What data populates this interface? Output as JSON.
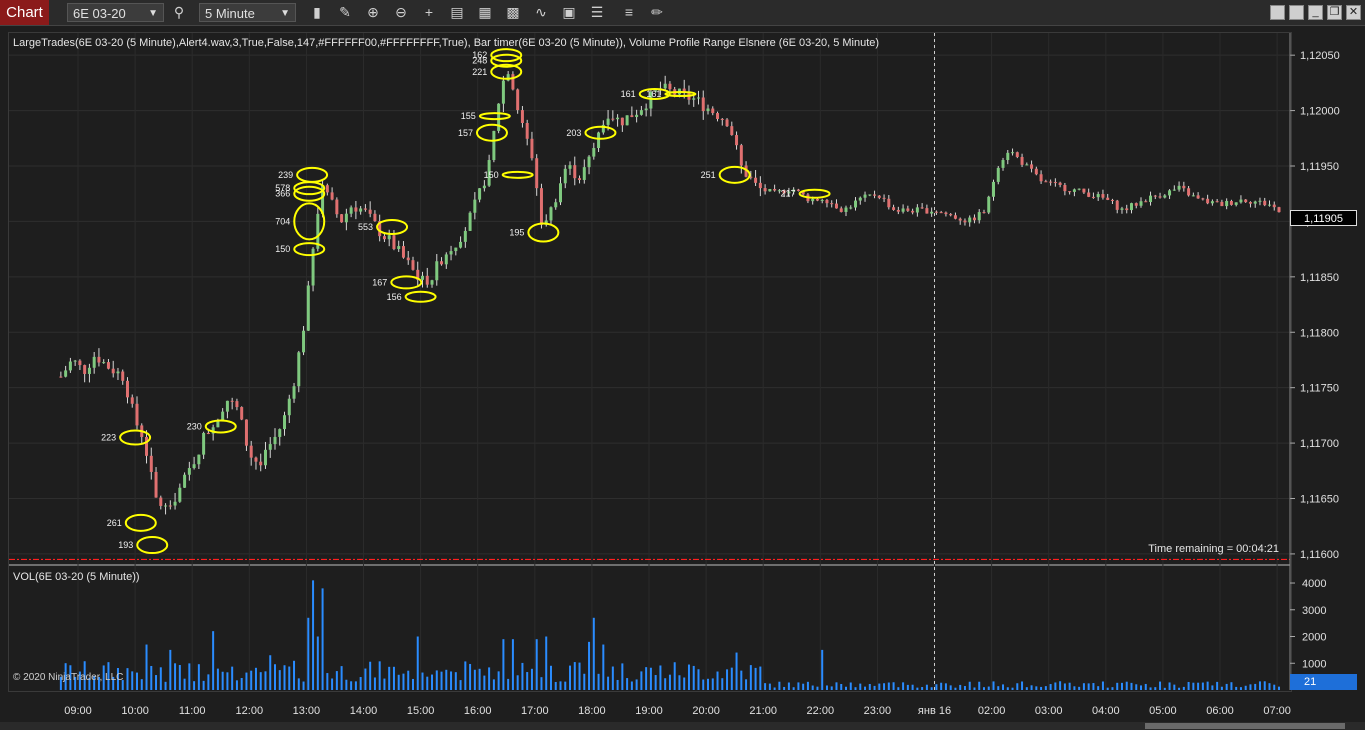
{
  "toolbar": {
    "tab": "Chart",
    "instrument": "6E 03-20",
    "interval": "5 Minute",
    "icons": [
      "search-icon",
      "bars-type-icon",
      "draw-icon",
      "zoom-in-icon",
      "zoom-out-icon",
      "crosshair-icon",
      "data-box-icon",
      "properties-icon",
      "strategies-icon",
      "indicators-icon",
      "templates-icon",
      "list-icon",
      "order-icon",
      "pencil-icon"
    ]
  },
  "panel": {
    "indicator_text": "LargeTrades(6E 03-20 (5 Minute),Alert4.wav,3,True,False,147,#FFFFFF00,#FFFFFFFF,True), Bar timer(6E 03-20 (5 Minute)), Volume Profile Range Elsnere (6E 03-20, 5 Minute)",
    "volume_title": "VOL(6E 03-20 (5 Minute))",
    "copyright": "© 2020 NinjaTrader, LLC",
    "time_remaining": "Time remaining = 00:04:21",
    "last_price": "1,11905",
    "last_volume": "21"
  },
  "colors": {
    "up": "#7fc97f",
    "down": "#e07070",
    "wick": "#d8d8d8",
    "ellipse": "#ffff00",
    "volume": "#2a8cff",
    "hline": "#ff2020"
  },
  "chart_data": {
    "type": "candlestick",
    "x_ticks": [
      "09:00",
      "10:00",
      "11:00",
      "12:00",
      "13:00",
      "14:00",
      "15:00",
      "16:00",
      "17:00",
      "18:00",
      "19:00",
      "20:00",
      "21:00",
      "22:00",
      "23:00",
      "янв 16",
      "02:00",
      "03:00",
      "04:00",
      "05:00",
      "06:00",
      "07:00"
    ],
    "y_ticks": [
      "1,12050",
      "1,12000",
      "1,11950",
      "1,11900",
      "1,11850",
      "1,11800",
      "1,11750",
      "1,11700",
      "1,11650",
      "1,11600"
    ],
    "ylim": [
      1.1159,
      1.1207
    ],
    "volume_ticks": [
      "4000",
      "3000",
      "2000",
      "1000"
    ],
    "volume_ylim": [
      0,
      4300
    ],
    "horizontal_line": 1.11595,
    "session_break": "янв 16",
    "price_path": [
      [
        8.7,
        1.1176
      ],
      [
        8.9,
        1.11775
      ],
      [
        9.1,
        1.11765
      ],
      [
        9.3,
        1.1178
      ],
      [
        9.5,
        1.1177
      ],
      [
        9.8,
        1.1176
      ],
      [
        10.0,
        1.1172
      ],
      [
        10.15,
        1.11705
      ],
      [
        10.35,
        1.1165
      ],
      [
        10.55,
        1.1164
      ],
      [
        10.8,
        1.1166
      ],
      [
        11.0,
        1.1168
      ],
      [
        11.2,
        1.11705
      ],
      [
        11.4,
        1.1172
      ],
      [
        11.6,
        1.1174
      ],
      [
        11.8,
        1.1173
      ],
      [
        12.0,
        1.1169
      ],
      [
        12.2,
        1.1168
      ],
      [
        12.4,
        1.117
      ],
      [
        12.6,
        1.1172
      ],
      [
        12.8,
        1.1176
      ],
      [
        13.0,
        1.1182
      ],
      [
        13.1,
        1.1187
      ],
      [
        13.25,
        1.1193
      ],
      [
        13.4,
        1.1192
      ],
      [
        13.6,
        1.119
      ],
      [
        13.8,
        1.11915
      ],
      [
        14.0,
        1.1191
      ],
      [
        14.3,
        1.1189
      ],
      [
        14.5,
        1.1188
      ],
      [
        14.8,
        1.1186
      ],
      [
        15.0,
        1.11845
      ],
      [
        15.2,
        1.1185
      ],
      [
        15.4,
        1.1187
      ],
      [
        15.6,
        1.1188
      ],
      [
        15.8,
        1.11895
      ],
      [
        16.0,
        1.1192
      ],
      [
        16.2,
        1.1195
      ],
      [
        16.4,
        1.1202
      ],
      [
        16.55,
        1.1204
      ],
      [
        16.75,
        1.1199
      ],
      [
        16.95,
        1.1196
      ],
      [
        17.15,
        1.1189
      ],
      [
        17.35,
        1.1192
      ],
      [
        17.55,
        1.1195
      ],
      [
        17.8,
        1.1194
      ],
      [
        18.0,
        1.1196
      ],
      [
        18.25,
        1.12
      ],
      [
        18.5,
        1.1199
      ],
      [
        18.8,
        1.12
      ],
      [
        19.0,
        1.1201
      ],
      [
        19.2,
        1.1202
      ],
      [
        19.5,
        1.12015
      ],
      [
        19.8,
        1.1201
      ],
      [
        20.1,
        1.12
      ],
      [
        20.4,
        1.1199
      ],
      [
        20.6,
        1.1195
      ],
      [
        20.9,
        1.1193
      ],
      [
        21.2,
        1.11925
      ],
      [
        21.5,
        1.1193
      ],
      [
        21.8,
        1.1192
      ],
      [
        22.1,
        1.1192
      ],
      [
        22.4,
        1.1191
      ],
      [
        22.7,
        1.1192
      ],
      [
        23.0,
        1.11925
      ],
      [
        23.3,
        1.1191
      ],
      [
        23.6,
        1.1191
      ],
      [
        24.0,
        1.1191
      ],
      [
        24.3,
        1.11905
      ],
      [
        24.6,
        1.119
      ],
      [
        24.9,
        1.1191
      ],
      [
        25.1,
        1.1195
      ],
      [
        25.3,
        1.11965
      ],
      [
        25.6,
        1.1195
      ],
      [
        25.9,
        1.11935
      ],
      [
        26.3,
        1.1193
      ],
      [
        26.7,
        1.11925
      ],
      [
        27.0,
        1.1192
      ],
      [
        27.3,
        1.1191
      ],
      [
        27.7,
        1.1192
      ],
      [
        28.0,
        1.11925
      ],
      [
        28.3,
        1.1193
      ],
      [
        28.6,
        1.1192
      ],
      [
        29.0,
        1.11915
      ],
      [
        29.4,
        1.1192
      ],
      [
        29.9,
        1.11915
      ],
      [
        30.1,
        1.11905
      ]
    ],
    "large_trades": [
      {
        "x": 10.0,
        "price": 1.11705,
        "label": "223",
        "w": 30,
        "h": 14
      },
      {
        "x": 10.1,
        "price": 1.11628,
        "label": "261",
        "w": 30,
        "h": 16
      },
      {
        "x": 10.3,
        "price": 1.11608,
        "label": "193",
        "w": 30,
        "h": 16
      },
      {
        "x": 11.5,
        "price": 1.11715,
        "label": "230",
        "w": 30,
        "h": 12
      },
      {
        "x": 13.1,
        "price": 1.11942,
        "label": "239",
        "w": 30,
        "h": 14
      },
      {
        "x": 13.05,
        "price": 1.1193,
        "label": "578",
        "w": 30,
        "h": 12
      },
      {
        "x": 13.05,
        "price": 1.11925,
        "label": "366",
        "w": 30,
        "h": 14
      },
      {
        "x": 13.05,
        "price": 1.119,
        "label": "704",
        "w": 30,
        "h": 36
      },
      {
        "x": 13.05,
        "price": 1.11875,
        "label": "150",
        "w": 30,
        "h": 12
      },
      {
        "x": 14.5,
        "price": 1.11895,
        "label": "553",
        "w": 30,
        "h": 14
      },
      {
        "x": 14.75,
        "price": 1.11845,
        "label": "167",
        "w": 30,
        "h": 12
      },
      {
        "x": 15.0,
        "price": 1.11832,
        "label": "156",
        "w": 30,
        "h": 10
      },
      {
        "x": 16.3,
        "price": 1.11995,
        "label": "155",
        "w": 30,
        "h": 6
      },
      {
        "x": 16.25,
        "price": 1.1198,
        "label": "157",
        "w": 30,
        "h": 16
      },
      {
        "x": 16.5,
        "price": 1.1205,
        "label": "162",
        "w": 30,
        "h": 12
      },
      {
        "x": 16.5,
        "price": 1.12045,
        "label": "248",
        "w": 30,
        "h": 12
      },
      {
        "x": 16.5,
        "price": 1.12035,
        "label": "221",
        "w": 30,
        "h": 14
      },
      {
        "x": 16.7,
        "price": 1.11942,
        "label": "150",
        "w": 30,
        "h": 6
      },
      {
        "x": 17.15,
        "price": 1.1189,
        "label": "195",
        "w": 30,
        "h": 18
      },
      {
        "x": 18.15,
        "price": 1.1198,
        "label": "203",
        "w": 30,
        "h": 12
      },
      {
        "x": 19.1,
        "price": 1.12015,
        "label": "161",
        "w": 30,
        "h": 10
      },
      {
        "x": 19.55,
        "price": 1.12015,
        "label": "161",
        "w": 30,
        "h": 4
      },
      {
        "x": 20.5,
        "price": 1.11942,
        "label": "251",
        "w": 30,
        "h": 16
      },
      {
        "x": 21.9,
        "price": 1.11925,
        "label": "217",
        "w": 30,
        "h": 8
      }
    ],
    "volume_spikes": [
      [
        13.1,
        4100
      ],
      [
        13.25,
        3800
      ],
      [
        13.0,
        2700
      ],
      [
        13.2,
        2000
      ],
      [
        11.3,
        2200
      ],
      [
        16.6,
        2300
      ],
      [
        16.55,
        1900
      ],
      [
        17.0,
        1900
      ],
      [
        17.2,
        2000
      ],
      [
        18.0,
        2700
      ],
      [
        18.2,
        1700
      ],
      [
        17.9,
        1800
      ],
      [
        14.9,
        2000
      ],
      [
        16.4,
        1900
      ],
      [
        10.2,
        1700
      ],
      [
        20.5,
        1400
      ],
      [
        22.0,
        1500
      ],
      [
        10.6,
        1500
      ],
      [
        12.3,
        1300
      ]
    ]
  }
}
